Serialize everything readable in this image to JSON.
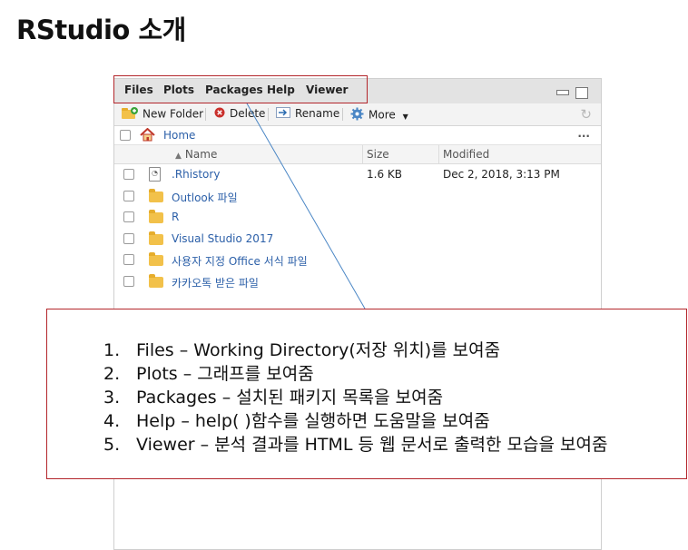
{
  "slide": {
    "title": "RStudio 소개"
  },
  "pane": {
    "tabs": [
      "Files",
      "Plots",
      "Packages",
      "Help",
      "Viewer"
    ],
    "toolbar": {
      "new_folder": "New Folder",
      "delete": "Delete",
      "rename": "Rename",
      "more": "More"
    },
    "path": {
      "home": "Home",
      "overflow": "..."
    },
    "columns": {
      "name": "Name",
      "size": "Size",
      "modified": "Modified"
    },
    "files": [
      {
        "name": ".Rhistory",
        "size": "1.6 KB",
        "modified": "Dec 2, 2018, 3:13 PM",
        "icon": "document-icon"
      },
      {
        "name": "Outlook 파일",
        "size": "",
        "modified": "",
        "icon": "folder-icon"
      },
      {
        "name": "R",
        "size": "",
        "modified": "",
        "icon": "folder-icon"
      },
      {
        "name": "Visual Studio 2017",
        "size": "",
        "modified": "",
        "icon": "folder-icon"
      },
      {
        "name": "사용자 지정 Office 서식 파일",
        "size": "",
        "modified": "",
        "icon": "folder-icon"
      },
      {
        "name": "카카오톡 받은 파일",
        "size": "",
        "modified": "",
        "icon": "folder-icon"
      }
    ]
  },
  "callout": {
    "items": [
      {
        "num": "1.",
        "text": "Files – Working Directory(저장 위치)를 보여줌"
      },
      {
        "num": "2.",
        "text": "Plots – 그래프를 보여줌"
      },
      {
        "num": "3.",
        "text": "Packages – 설치된 패키지 목록을 보여줌"
      },
      {
        "num": "4.",
        "text": "Help – help( )함수를 실행하면 도움말을 보여줌"
      },
      {
        "num": "5.",
        "text": "Viewer – 분석 결과를 HTML 등 웹 문서로  출력한 모습을 보여줌"
      }
    ]
  },
  "colors": {
    "highlight": "#b3262b",
    "link": "#2b5fa8",
    "folder": "#f2c14a"
  }
}
